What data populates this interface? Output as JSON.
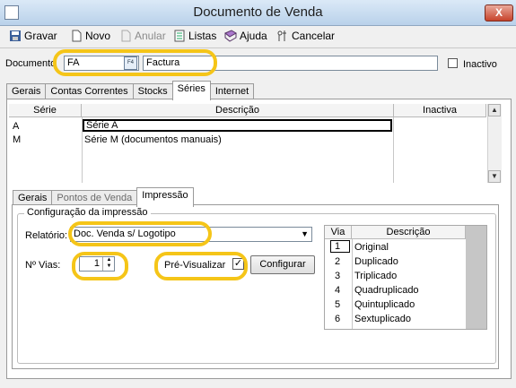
{
  "window": {
    "title": "Documento de Venda",
    "close_symbol": "X"
  },
  "toolbar": {
    "gravar": "Gravar",
    "novo": "Novo",
    "anular": "Anular",
    "listas": "Listas",
    "ajuda": "Ajuda",
    "cancelar": "Cancelar"
  },
  "documento": {
    "label": "Documento",
    "code": "FA",
    "lookup_glyph": "F4",
    "description": "Factura",
    "inactivo_label": "Inactivo",
    "inactivo_checked": false
  },
  "main_tabs": [
    "Gerais",
    "Contas Correntes",
    "Stocks",
    "Séries",
    "Internet"
  ],
  "series_grid": {
    "headers": [
      "Série",
      "Descrição",
      "Inactiva"
    ],
    "rows": [
      {
        "serie": "A",
        "descricao": "Série A",
        "inactiva": ""
      },
      {
        "serie": "M",
        "descricao": "Série M (documentos manuais)",
        "inactiva": ""
      }
    ]
  },
  "sub_tabs": [
    "Gerais",
    "Pontos de Venda",
    "Impressão"
  ],
  "impressao": {
    "group_title": "Configuração da impressão",
    "relatorio_label": "Relatório:",
    "relatorio_value": "Doc. Venda s/ Logotipo",
    "vias_label": "Nº Vias:",
    "vias_value": "1",
    "pre_visualizar_label": "Pré-Visualizar",
    "pre_visualizar_checked": true,
    "configurar_label": "Configurar"
  },
  "vias_grid": {
    "headers": [
      "Via",
      "Descrição"
    ],
    "rows": [
      {
        "via": "1",
        "descricao": "Original"
      },
      {
        "via": "2",
        "descricao": "Duplicado"
      },
      {
        "via": "3",
        "descricao": "Triplicado"
      },
      {
        "via": "4",
        "descricao": "Quadruplicado"
      },
      {
        "via": "5",
        "descricao": "Quintuplicado"
      },
      {
        "via": "6",
        "descricao": "Sextuplicado"
      }
    ]
  },
  "colors": {
    "highlight": "#f5c518",
    "titlebar": "#b9d1ea",
    "close": "#c7432b"
  }
}
